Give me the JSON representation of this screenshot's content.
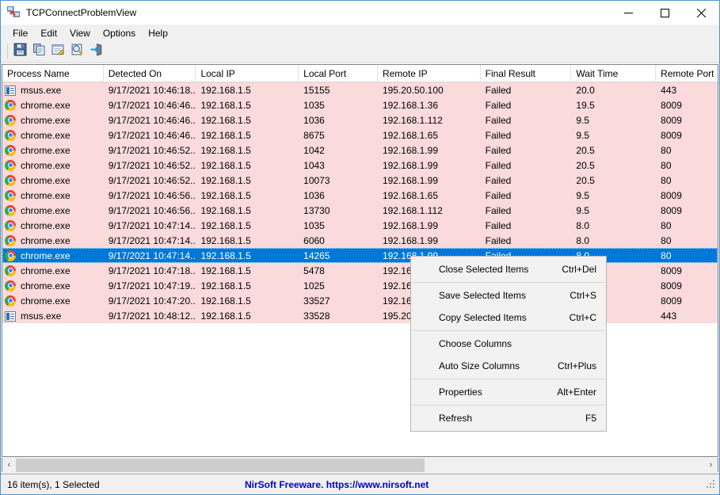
{
  "window": {
    "title": "TCPConnectProblemView",
    "icon": "network-connection-icon",
    "minimize_label": "Minimize",
    "maximize_label": "Maximize",
    "close_label": "Close"
  },
  "menubar": {
    "items": [
      {
        "label": "File"
      },
      {
        "label": "Edit"
      },
      {
        "label": "View"
      },
      {
        "label": "Options"
      },
      {
        "label": "Help"
      }
    ]
  },
  "toolbar": {
    "buttons": [
      {
        "icon": "save-icon",
        "label": "Save"
      },
      {
        "icon": "copy-icon",
        "label": "Copy"
      },
      {
        "icon": "properties-icon",
        "label": "Properties"
      },
      {
        "icon": "find-icon",
        "label": "Find"
      },
      {
        "icon": "exit-icon",
        "label": "Exit"
      }
    ]
  },
  "table": {
    "columns": [
      {
        "label": "Process Name",
        "width": 128
      },
      {
        "label": "Detected On",
        "width": 117
      },
      {
        "label": "Local IP",
        "width": 130
      },
      {
        "label": "Local Port",
        "width": 100
      },
      {
        "label": "Remote IP",
        "width": 130
      },
      {
        "label": "Final Result",
        "width": 115
      },
      {
        "label": "Wait Time",
        "width": 107
      },
      {
        "label": "Remote Port",
        "width": 78
      }
    ],
    "rows": [
      {
        "icon": "document-icon",
        "process": "msus.exe",
        "detected": "9/17/2021 10:46:18...",
        "local_ip": "192.168.1.5",
        "local_port": "15155",
        "remote_ip": "195.20.50.100",
        "result": "Failed",
        "wait": "20.0",
        "remote_port": "443",
        "selected": false
      },
      {
        "icon": "chrome-icon",
        "process": "chrome.exe",
        "detected": "9/17/2021 10:46:46...",
        "local_ip": "192.168.1.5",
        "local_port": "1035",
        "remote_ip": "192.168.1.36",
        "result": "Failed",
        "wait": "19.5",
        "remote_port": "8009",
        "selected": false
      },
      {
        "icon": "chrome-icon",
        "process": "chrome.exe",
        "detected": "9/17/2021 10:46:46...",
        "local_ip": "192.168.1.5",
        "local_port": "1036",
        "remote_ip": "192.168.1.112",
        "result": "Failed",
        "wait": "9.5",
        "remote_port": "8009",
        "selected": false
      },
      {
        "icon": "chrome-icon",
        "process": "chrome.exe",
        "detected": "9/17/2021 10:46:46...",
        "local_ip": "192.168.1.5",
        "local_port": "8675",
        "remote_ip": "192.168.1.65",
        "result": "Failed",
        "wait": "9.5",
        "remote_port": "8009",
        "selected": false
      },
      {
        "icon": "chrome-icon",
        "process": "chrome.exe",
        "detected": "9/17/2021 10:46:52...",
        "local_ip": "192.168.1.5",
        "local_port": "1042",
        "remote_ip": "192.168.1.99",
        "result": "Failed",
        "wait": "20.5",
        "remote_port": "80",
        "selected": false
      },
      {
        "icon": "chrome-icon",
        "process": "chrome.exe",
        "detected": "9/17/2021 10:46:52...",
        "local_ip": "192.168.1.5",
        "local_port": "1043",
        "remote_ip": "192.168.1.99",
        "result": "Failed",
        "wait": "20.5",
        "remote_port": "80",
        "selected": false
      },
      {
        "icon": "chrome-icon",
        "process": "chrome.exe",
        "detected": "9/17/2021 10:46:52...",
        "local_ip": "192.168.1.5",
        "local_port": "10073",
        "remote_ip": "192.168.1.99",
        "result": "Failed",
        "wait": "20.5",
        "remote_port": "80",
        "selected": false
      },
      {
        "icon": "chrome-icon",
        "process": "chrome.exe",
        "detected": "9/17/2021 10:46:56...",
        "local_ip": "192.168.1.5",
        "local_port": "1036",
        "remote_ip": "192.168.1.65",
        "result": "Failed",
        "wait": "9.5",
        "remote_port": "8009",
        "selected": false
      },
      {
        "icon": "chrome-icon",
        "process": "chrome.exe",
        "detected": "9/17/2021 10:46:56...",
        "local_ip": "192.168.1.5",
        "local_port": "13730",
        "remote_ip": "192.168.1.112",
        "result": "Failed",
        "wait": "9.5",
        "remote_port": "8009",
        "selected": false
      },
      {
        "icon": "chrome-icon",
        "process": "chrome.exe",
        "detected": "9/17/2021 10:47:14...",
        "local_ip": "192.168.1.5",
        "local_port": "1035",
        "remote_ip": "192.168.1.99",
        "result": "Failed",
        "wait": "8.0",
        "remote_port": "80",
        "selected": false
      },
      {
        "icon": "chrome-icon",
        "process": "chrome.exe",
        "detected": "9/17/2021 10:47:14...",
        "local_ip": "192.168.1.5",
        "local_port": "6060",
        "remote_ip": "192.168.1.99",
        "result": "Failed",
        "wait": "8.0",
        "remote_port": "80",
        "selected": false
      },
      {
        "icon": "chrome-icon",
        "process": "chrome.exe",
        "detected": "9/17/2021 10:47:14...",
        "local_ip": "192.168.1.5",
        "local_port": "14265",
        "remote_ip": "192.168.1.99",
        "result": "Failed",
        "wait": "8.0",
        "remote_port": "80",
        "selected": true
      },
      {
        "icon": "chrome-icon",
        "process": "chrome.exe",
        "detected": "9/17/2021 10:47:18...",
        "local_ip": "192.168.1.5",
        "local_port": "5478",
        "remote_ip": "192.16",
        "result": "",
        "wait": "",
        "remote_port": "8009",
        "selected": false
      },
      {
        "icon": "chrome-icon",
        "process": "chrome.exe",
        "detected": "9/17/2021 10:47:19...",
        "local_ip": "192.168.1.5",
        "local_port": "1025",
        "remote_ip": "192.16",
        "result": "",
        "wait": "",
        "remote_port": "8009",
        "selected": false
      },
      {
        "icon": "chrome-icon",
        "process": "chrome.exe",
        "detected": "9/17/2021 10:47:20...",
        "local_ip": "192.168.1.5",
        "local_port": "33527",
        "remote_ip": "192.16",
        "result": "",
        "wait": "",
        "remote_port": "8009",
        "selected": false
      },
      {
        "icon": "document-icon",
        "process": "msus.exe",
        "detected": "9/17/2021 10:48:12...",
        "local_ip": "192.168.1.5",
        "local_port": "33528",
        "remote_ip": "195.20",
        "result": "",
        "wait": "",
        "remote_port": "443",
        "selected": false
      }
    ]
  },
  "context_menu": {
    "items": [
      {
        "type": "item",
        "label": "Close Selected Items",
        "shortcut": "Ctrl+Del"
      },
      {
        "type": "separator"
      },
      {
        "type": "item",
        "label": "Save Selected Items",
        "shortcut": "Ctrl+S"
      },
      {
        "type": "item",
        "label": "Copy Selected Items",
        "shortcut": "Ctrl+C"
      },
      {
        "type": "separator"
      },
      {
        "type": "item",
        "label": "Choose Columns",
        "shortcut": ""
      },
      {
        "type": "item",
        "label": "Auto Size Columns",
        "shortcut": "Ctrl+Plus"
      },
      {
        "type": "separator"
      },
      {
        "type": "item",
        "label": "Properties",
        "shortcut": "Alt+Enter"
      },
      {
        "type": "separator"
      },
      {
        "type": "item",
        "label": "Refresh",
        "shortcut": "F5"
      }
    ]
  },
  "scrollbar": {
    "left_arrow": "‹",
    "right_arrow": "›"
  },
  "statusbar": {
    "items_text": "16 item(s), 1 Selected",
    "link_text": "NirSoft Freeware. https://www.nirsoft.net"
  },
  "colors": {
    "window_border": "#4a96d2",
    "row_pink": "#fadada",
    "selection_blue": "#0078d7",
    "link_blue": "#0000cd"
  }
}
